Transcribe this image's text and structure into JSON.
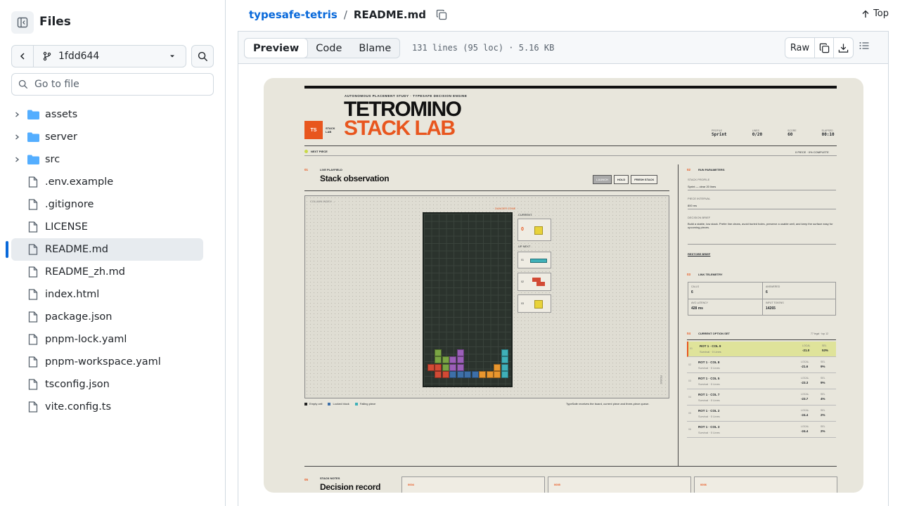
{
  "sidebar": {
    "title": "Files",
    "branch": "1fdd644",
    "goto_placeholder": "Go to file",
    "items": [
      {
        "label": "assets",
        "type": "dir"
      },
      {
        "label": "server",
        "type": "dir"
      },
      {
        "label": "src",
        "type": "dir"
      },
      {
        "label": ".env.example",
        "type": "file"
      },
      {
        "label": ".gitignore",
        "type": "file"
      },
      {
        "label": "LICENSE",
        "type": "file"
      },
      {
        "label": "README.md",
        "type": "file",
        "active": true
      },
      {
        "label": "README_zh.md",
        "type": "file"
      },
      {
        "label": "index.html",
        "type": "file"
      },
      {
        "label": "package.json",
        "type": "file"
      },
      {
        "label": "pnpm-lock.yaml",
        "type": "file"
      },
      {
        "label": "pnpm-workspace.yaml",
        "type": "file"
      },
      {
        "label": "tsconfig.json",
        "type": "file"
      },
      {
        "label": "vite.config.ts",
        "type": "file"
      }
    ]
  },
  "header": {
    "repo": "typesafe-tetris",
    "separator": "/",
    "file": "README.md",
    "top_label": "Top"
  },
  "toolbar": {
    "tabs": [
      "Preview",
      "Code",
      "Blame"
    ],
    "active_tab": "Preview",
    "meta": "131 lines (95 loc) · 5.16 KB",
    "raw_label": "Raw"
  },
  "preview": {
    "kicker": "AUTONOMOUS PLACEMENT STUDY · TYPESAFE DECISION ENGINE",
    "title_line1": "TETROMINO",
    "title_line2": "STACK LAB",
    "badge": "TS",
    "badge_sub_1": "STACK",
    "badge_sub_2": "LAB",
    "stats": [
      {
        "k": "PROFILE",
        "v": "Sprint"
      },
      {
        "k": "LINES",
        "v": "0/20"
      },
      {
        "k": "SCORE",
        "v": "60"
      },
      {
        "k": "ELAPSED",
        "v": "00:10"
      }
    ],
    "next_piece": "NEXT PIECE",
    "progress": "0 PIECE · 0% COMPLETE",
    "sec1_num": "01",
    "sec1_kicker": "LIVE PLAYFIELD",
    "sec1_title": "Stack observation",
    "buttons": [
      "LAUNCH",
      "HOLD",
      "FRESH STACK"
    ],
    "column_index": "COLUMN INDEX →",
    "danger": "DANGER ZONE",
    "current": "CURRENT",
    "current_num": "0",
    "up_next": "UP NEXT",
    "queue_labels": [
      "01",
      "02",
      "03"
    ],
    "rows_label": "ROWS",
    "legend": [
      "Empty cell",
      "Locked block",
      "Falling piece"
    ],
    "legend_note": "TypeSafe receives the board, current piece and three-piece queue.",
    "sec2_num": "02",
    "sec2_title": "RUN PARAMETERS",
    "stack_profile_k": "STACK PROFILE",
    "stack_profile_v": "Sprint — clear 20 lines",
    "interval_k": "PIECE INTERVAL",
    "interval_v": "800 ms",
    "brief_k": "DECISION BRIEF",
    "brief_v": "Build a stable, low stack. Prefer line clears, avoid buried holes, preserve a usable well, and keep the surface easy for upcoming pieces.",
    "restore": "RESTORE BRIEF",
    "sec3_num": "03",
    "sec3_title": "LINK TELEMETRY",
    "telemetry": [
      {
        "k": "CALLS",
        "v": "6"
      },
      {
        "k": "ANSWERED",
        "v": "6"
      },
      {
        "k": "AVG LATENCY",
        "v": "428 ms"
      },
      {
        "k": "INPUT TOKENS",
        "v": "14265"
      }
    ],
    "sec4_num": "04",
    "sec4_title": "CURRENT OPTION SET",
    "sec4_meta": "77 legal · top 12",
    "options": [
      {
        "ix": "01",
        "name": "ROT 1 · COL 9",
        "sub": "Survival · 0 Lines",
        "lv": "-21.0",
        "pc": "53%"
      },
      {
        "ix": "02",
        "name": "ROT 1 · COL 8",
        "sub": "Survival · 0 Lines",
        "lv": "-21.6",
        "pc": "9%"
      },
      {
        "ix": "03",
        "name": "ROT 1 · COL 5",
        "sub": "Survival · 0 Lines",
        "lv": "-23.3",
        "pc": "9%"
      },
      {
        "ix": "04",
        "name": "ROT 1 · COL 7",
        "sub": "Survival · 0 Lines",
        "lv": "-23.7",
        "pc": "4%"
      },
      {
        "ix": "05",
        "name": "ROT 1 · COL 2",
        "sub": "Survival · 0 Lines",
        "lv": "-24.4",
        "pc": "2%"
      },
      {
        "ix": "06",
        "name": "ROT 1 · COL 3",
        "sub": "Survival · 0 Lines",
        "lv": "-24.4",
        "pc": "2%"
      }
    ],
    "local_k": "LOCAL",
    "sel_k": "SEL",
    "sec5_num": "05",
    "sec5_kicker": "STACK NOTES",
    "sec5_title": "Decision record",
    "notes": [
      "0004",
      "0005",
      "0006"
    ]
  },
  "colors": {
    "accent": "#0969da",
    "orange": "#e8561e",
    "board": "#2b332d"
  }
}
